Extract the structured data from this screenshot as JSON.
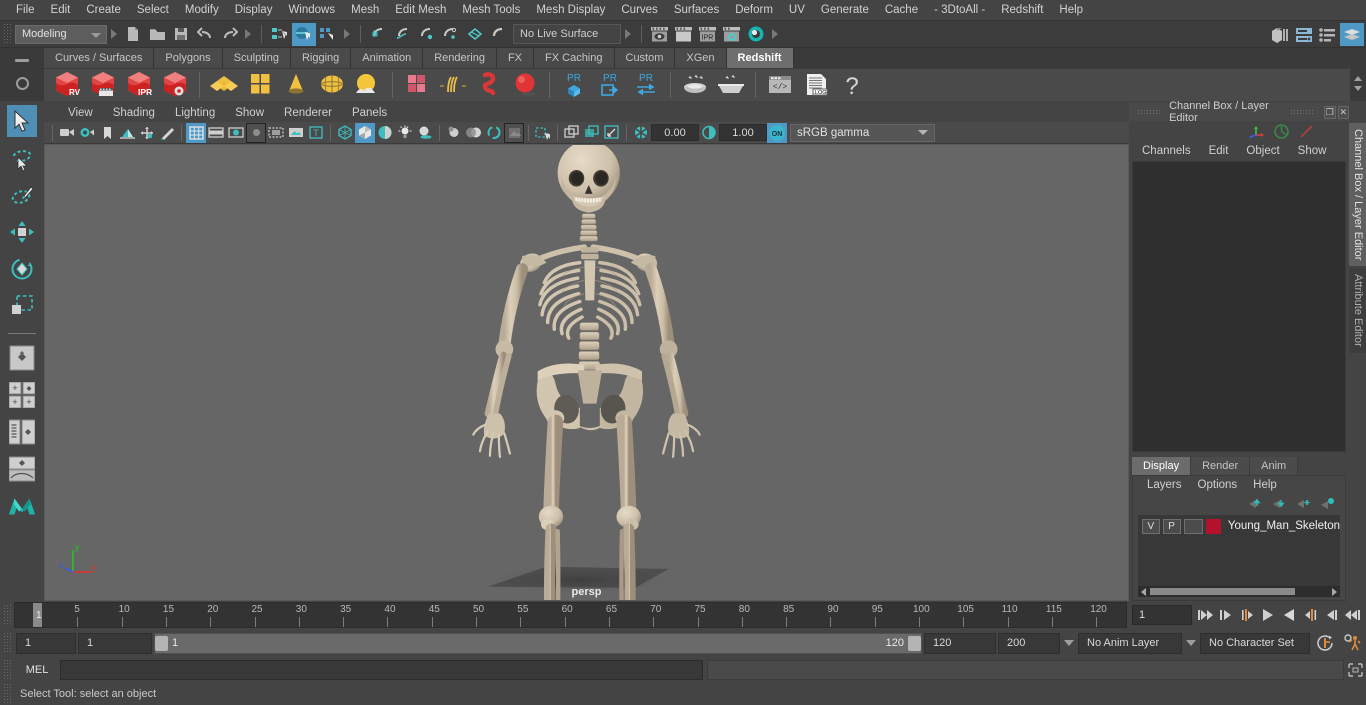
{
  "app": {
    "title": "Autodesk Maya",
    "menus": [
      "File",
      "Edit",
      "Create",
      "Select",
      "Modify",
      "Display",
      "Windows",
      "Mesh",
      "Edit Mesh",
      "Mesh Tools",
      "Mesh Display",
      "Curves",
      "Surfaces",
      "Deform",
      "UV",
      "Generate",
      "Cache",
      "- 3DtoAll -",
      "Redshift",
      "Help"
    ]
  },
  "status_line": {
    "menu_set": "Modeling",
    "live_surface": "No Live Surface",
    "icons": [
      "new-scene-icon",
      "open-scene-icon",
      "save-scene-icon",
      "undo-icon",
      "redo-icon",
      "select-by-hierarchy-icon",
      "select-by-object-icon",
      "select-by-component-icon",
      "snap-to-grid-icon",
      "snap-to-curve-icon",
      "snap-to-point-icon",
      "snap-to-projected-center-icon",
      "snap-to-view-plane-icon",
      "make-live-icon",
      "render-view-icon",
      "render-current-frame-icon",
      "ipr-render-icon",
      "render-settings-icon",
      "hypershade-icon"
    ],
    "right_icons": [
      "show-hide-modeling-toolkit-icon",
      "show-hide-attribute-editor-icon",
      "show-hide-tool-settings-icon",
      "show-hide-channel-box-icon"
    ]
  },
  "shelf": {
    "tabs": [
      "Curves / Surfaces",
      "Polygons",
      "Sculpting",
      "Rigging",
      "Animation",
      "Rendering",
      "FX",
      "FX Caching",
      "Custom",
      "XGen",
      "Redshift"
    ],
    "active_tab": "Redshift",
    "items": [
      {
        "name": "redshift-render-view-icon",
        "label": "RV"
      },
      {
        "name": "redshift-render-sequence-icon",
        "label": ""
      },
      {
        "name": "redshift-ipr-icon",
        "label": "IPR"
      },
      {
        "name": "redshift-render-settings-icon",
        "label": ""
      },
      {
        "name": "redshift-material-icon",
        "label": ""
      },
      {
        "name": "redshift-texture-icon",
        "label": ""
      },
      {
        "name": "redshift-cone-light-icon",
        "label": ""
      },
      {
        "name": "redshift-dome-light-icon",
        "label": ""
      },
      {
        "name": "redshift-environment-icon",
        "label": ""
      },
      {
        "name": "redshift-proxy-icon",
        "label": ""
      },
      {
        "name": "redshift-hair-icon",
        "label": ""
      },
      {
        "name": "redshift-volume-icon",
        "label": ""
      },
      {
        "name": "redshift-sphere-icon",
        "label": ""
      },
      {
        "name": "redshift-pr-object-icon",
        "label": "PR"
      },
      {
        "name": "redshift-pr-export-icon",
        "label": "PR"
      },
      {
        "name": "redshift-pr-swap-icon",
        "label": "PR"
      },
      {
        "name": "redshift-bake-icon",
        "label": ""
      },
      {
        "name": "redshift-bake-set-icon",
        "label": ""
      },
      {
        "name": "redshift-script-editor-icon",
        "label": ""
      },
      {
        "name": "redshift-log-icon",
        "label": ".LOG"
      },
      {
        "name": "redshift-help-icon",
        "label": "?"
      }
    ]
  },
  "toolbox": {
    "items": [
      {
        "name": "select-tool",
        "selected": true
      },
      {
        "name": "lasso-select-tool",
        "selected": false
      },
      {
        "name": "paint-select-tool",
        "selected": false
      },
      {
        "name": "move-tool",
        "selected": false
      },
      {
        "name": "rotate-tool",
        "selected": false
      },
      {
        "name": "scale-tool",
        "selected": false
      },
      {
        "name": "last-tool-used",
        "selected": false
      },
      {
        "name": "single-perspective-layout",
        "selected": false
      },
      {
        "name": "four-view-layout",
        "selected": false
      },
      {
        "name": "outliner-persp-layout",
        "selected": false
      },
      {
        "name": "persp-graph-layout",
        "selected": false
      },
      {
        "name": "maya-logo",
        "selected": false
      }
    ]
  },
  "viewport": {
    "menus": [
      "View",
      "Shading",
      "Lighting",
      "Show",
      "Renderer",
      "Panels"
    ],
    "camera_label": "persp",
    "exposure": "0.00",
    "gamma": "1.00",
    "color_management": "sRGB gamma",
    "color_management_toggle": "ON",
    "axis_labels": {
      "x": "x",
      "y": "y",
      "z": "z"
    },
    "axis_colors": {
      "x": "#e03030",
      "y": "#24c424",
      "z": "#3a5ae8"
    },
    "toolbar_icons": [
      "select-camera-icon",
      "camera-attributes-icon",
      "bookmark-icon",
      "image-plane-icon",
      "two-d-pan-zoom-icon",
      "grease-pencil-icon",
      "grid-toggle-icon",
      "film-gate-icon",
      "resolution-gate-icon",
      "gate-mask-icon",
      "film-origin-icon",
      "exposure-icon",
      "text-overlay-icon",
      "wireframe-icon",
      "smooth-shade-icon",
      "shaded-wireframe-icon",
      "lights-icon",
      "shadows-icon",
      "screen-space-ao-icon",
      "motion-blur-icon",
      "multisample-icon",
      "isolate-select-icon",
      "xray-icon",
      "xray-joints-icon",
      "xray-active-icon",
      "aperture-icon",
      "gamma-icon",
      "color-management-icon"
    ]
  },
  "channel_box": {
    "panel_title": "Channel Box / Layer Editor",
    "menus": [
      "Channels",
      "Edit",
      "Object",
      "Show"
    ],
    "icons": [
      "channel-box-transform-icon",
      "channel-box-anim-icon",
      "channel-box-keyable-icon"
    ],
    "window_buttons": [
      "restore-window-icon",
      "close-window-icon"
    ]
  },
  "layer_editor": {
    "tabs": [
      "Display",
      "Render",
      "Anim"
    ],
    "active_tab": "Display",
    "menus": [
      "Layers",
      "Options",
      "Help"
    ],
    "toolbar_icons": [
      "move-layer-up-icon",
      "move-layer-down-icon",
      "create-new-layer-icon",
      "create-layer-from-selected-icon"
    ],
    "layers": [
      {
        "visibility": "V",
        "playback": "P",
        "shading": "",
        "color": "#b4112c",
        "name": "Young_Man_Skeleton"
      }
    ]
  },
  "right_vertical_tabs": [
    {
      "label": "Channel Box / Layer Editor",
      "active": true
    },
    {
      "label": "Attribute Editor",
      "active": false
    }
  ],
  "time_slider": {
    "current_frame": "1",
    "current_frame_field": "1",
    "tick_labels": [
      "5",
      "10",
      "15",
      "20",
      "25",
      "30",
      "35",
      "40",
      "45",
      "50",
      "55",
      "60",
      "65",
      "70",
      "75",
      "80",
      "85",
      "90",
      "95",
      "100",
      "105",
      "110",
      "115",
      "120"
    ],
    "playback_buttons": [
      "go-to-start-icon",
      "step-back-keyframe-icon",
      "step-back-frame-icon",
      "play-backwards-icon",
      "play-forwards-icon",
      "step-forward-frame-icon",
      "step-forward-keyframe-icon",
      "go-to-end-icon"
    ]
  },
  "range_slider": {
    "anim_start": "1",
    "range_start": "1",
    "bar_start_label": "1",
    "bar_end_label": "120",
    "range_end": "120",
    "anim_end": "200",
    "anim_layer": "No Anim Layer",
    "character_set": "No Character Set",
    "right_icons": [
      "auto-key-icon",
      "animation-preferences-icon"
    ]
  },
  "command_line": {
    "language": "MEL",
    "input_value": "",
    "input_placeholder": "",
    "output_value": "",
    "expand_icon": "expand-script-editor-icon"
  },
  "help_line": {
    "text": "Select Tool: select an object"
  },
  "colors": {
    "accent_blue": "#4f99c6",
    "window_bg": "#444444",
    "viewport_bg": "#666666",
    "layer_red": "#b4112c",
    "bone": "#d8cdbb"
  }
}
